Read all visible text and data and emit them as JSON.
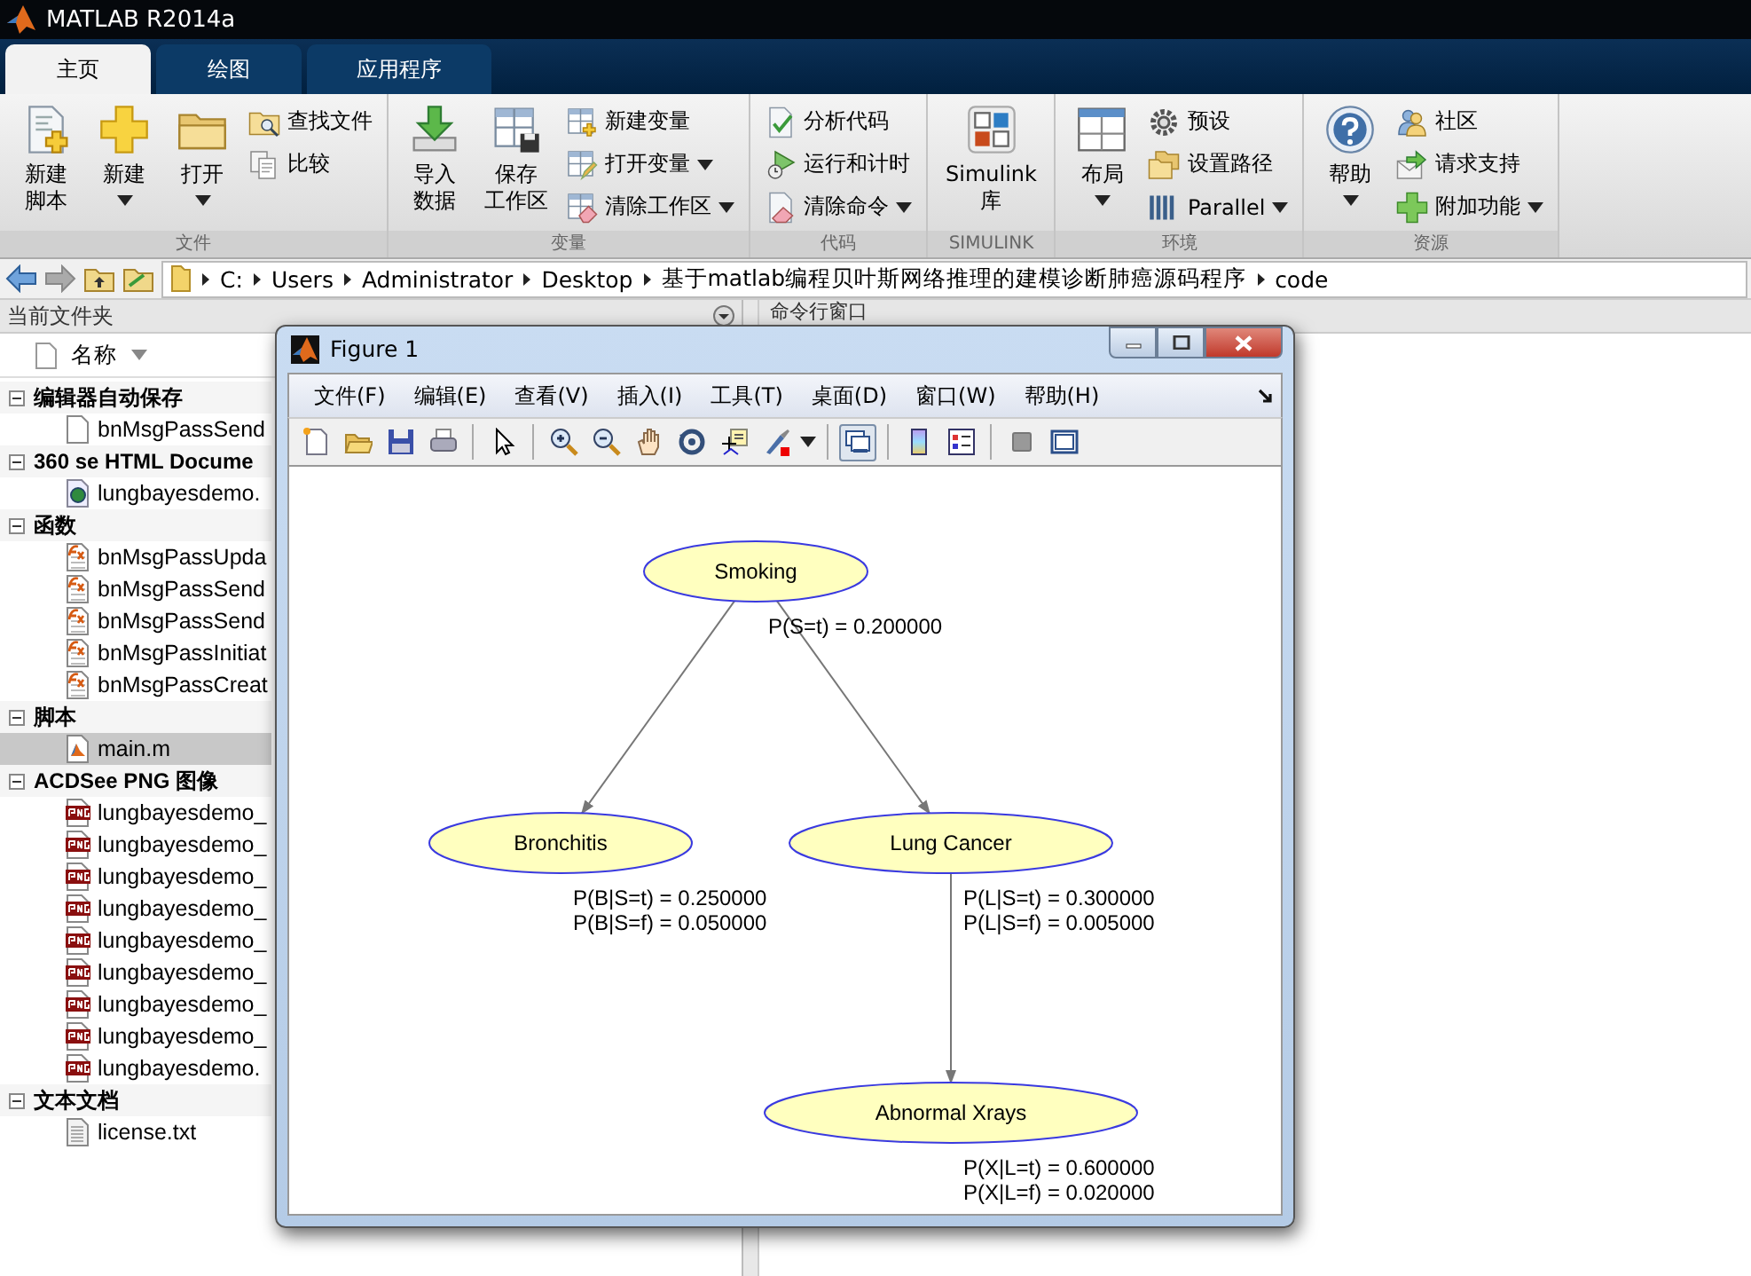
{
  "window": {
    "title": "MATLAB R2014a"
  },
  "tabs": [
    {
      "label": "主页",
      "selected": true
    },
    {
      "label": "绘图",
      "selected": false
    },
    {
      "label": "应用程序",
      "selected": false
    }
  ],
  "toolstrip": [
    {
      "label": "文件",
      "buttons": [
        {
          "kind": "large",
          "lines": [
            "新建",
            "脚本"
          ],
          "dropdown": false
        },
        {
          "kind": "large",
          "lines": [
            "新建"
          ],
          "dropdown": true
        },
        {
          "kind": "large",
          "lines": [
            "打开"
          ],
          "dropdown": true
        },
        {
          "kind": "small",
          "label": "查找文件",
          "dropdown": false
        },
        {
          "kind": "small",
          "label": "比较",
          "dropdown": false
        }
      ]
    },
    {
      "label": "变量",
      "buttons": [
        {
          "kind": "large",
          "lines": [
            "导入",
            "数据"
          ],
          "dropdown": false
        },
        {
          "kind": "large",
          "lines": [
            "保存",
            "工作区"
          ],
          "dropdown": false
        },
        {
          "kind": "small",
          "label": "新建变量",
          "dropdown": false
        },
        {
          "kind": "small",
          "label": "打开变量",
          "dropdown": true
        },
        {
          "kind": "small",
          "label": "清除工作区",
          "dropdown": true
        }
      ]
    },
    {
      "label": "代码",
      "buttons": [
        {
          "kind": "small",
          "label": "分析代码",
          "dropdown": false
        },
        {
          "kind": "small",
          "label": "运行和计时",
          "dropdown": false
        },
        {
          "kind": "small",
          "label": "清除命令",
          "dropdown": true
        }
      ]
    },
    {
      "label": "SIMULINK",
      "buttons": [
        {
          "kind": "large",
          "lines": [
            "Simulink",
            "库"
          ],
          "dropdown": false
        }
      ]
    },
    {
      "label": "环境",
      "buttons": [
        {
          "kind": "large",
          "lines": [
            "布局"
          ],
          "dropdown": true
        },
        {
          "kind": "small",
          "label": "预设",
          "dropdown": false
        },
        {
          "kind": "small",
          "label": "设置路径",
          "dropdown": false
        },
        {
          "kind": "small",
          "label": "Parallel",
          "dropdown": true
        }
      ]
    },
    {
      "label": "资源",
      "buttons": [
        {
          "kind": "large",
          "lines": [
            "帮助"
          ],
          "dropdown": true
        },
        {
          "kind": "small",
          "label": "社区",
          "dropdown": false
        },
        {
          "kind": "small",
          "label": "请求支持",
          "dropdown": false
        },
        {
          "kind": "small",
          "label": "附加功能",
          "dropdown": true
        }
      ]
    }
  ],
  "address_bar": {
    "segments": [
      "C:",
      "Users",
      "Administrator",
      "Desktop",
      "基于matlab编程贝叶斯网络推理的建模诊断肺癌源码程序",
      "code"
    ]
  },
  "current_folder": {
    "title": "当前文件夹",
    "column": "名称",
    "groups": [
      {
        "label": "编辑器自动保存",
        "expanded": true,
        "items": [
          {
            "kind": "blank",
            "name": "bnMsgPassSend",
            "selected": false
          }
        ]
      },
      {
        "label": "360 se HTML Docume",
        "expanded": true,
        "items": [
          {
            "kind": "web",
            "name": "lungbayesdemo.",
            "selected": false
          }
        ]
      },
      {
        "label": "函数",
        "expanded": true,
        "items": [
          {
            "kind": "function",
            "name": "bnMsgPassUpda",
            "selected": false
          },
          {
            "kind": "function",
            "name": "bnMsgPassSend",
            "selected": false
          },
          {
            "kind": "function",
            "name": "bnMsgPassSend",
            "selected": false
          },
          {
            "kind": "function",
            "name": "bnMsgPassInitiat",
            "selected": false
          },
          {
            "kind": "function",
            "name": "bnMsgPassCreat",
            "selected": false
          }
        ]
      },
      {
        "label": "脚本",
        "expanded": true,
        "items": [
          {
            "kind": "script",
            "name": "main.m",
            "selected": true
          }
        ]
      },
      {
        "label": "ACDSee PNG 图像",
        "expanded": true,
        "items": [
          {
            "kind": "png",
            "name": "lungbayesdemo_",
            "selected": false
          },
          {
            "kind": "png",
            "name": "lungbayesdemo_",
            "selected": false
          },
          {
            "kind": "png",
            "name": "lungbayesdemo_",
            "selected": false
          },
          {
            "kind": "png",
            "name": "lungbayesdemo_",
            "selected": false
          },
          {
            "kind": "png",
            "name": "lungbayesdemo_",
            "selected": false
          },
          {
            "kind": "png",
            "name": "lungbayesdemo_",
            "selected": false
          },
          {
            "kind": "png",
            "name": "lungbayesdemo_",
            "selected": false
          },
          {
            "kind": "png",
            "name": "lungbayesdemo_",
            "selected": false
          },
          {
            "kind": "png",
            "name": "lungbayesdemo.",
            "selected": false
          }
        ]
      },
      {
        "label": "文本文档",
        "expanded": true,
        "items": [
          {
            "kind": "text",
            "name": "license.txt",
            "selected": false
          }
        ]
      }
    ]
  },
  "command_window": {
    "title": "命令行窗口"
  },
  "figure": {
    "title": "Figure 1",
    "menu": [
      "文件(F)",
      "编辑(E)",
      "查看(V)",
      "插入(I)",
      "工具(T)",
      "桌面(D)",
      "窗口(W)",
      "帮助(H)"
    ],
    "toolbar": [
      {
        "pressed": false
      },
      {
        "pressed": false
      },
      {
        "pressed": false
      },
      {
        "pressed": false
      },
      {
        "pressed": false
      },
      {
        "pressed": false
      },
      {
        "pressed": false
      },
      {
        "pressed": false
      },
      {
        "pressed": false
      },
      {
        "pressed": false
      },
      {
        "pressed": false
      },
      {
        "pressed": true
      },
      {
        "pressed": false
      },
      {
        "pressed": false
      },
      {
        "pressed": false
      },
      {
        "pressed": false
      }
    ],
    "graph": {
      "nodes": [
        {
          "label": "Smoking",
          "probabilities": [
            "P(S=t) = 0.200000"
          ]
        },
        {
          "label": "Bronchitis",
          "probabilities": [
            "P(B|S=t) = 0.250000",
            "P(B|S=f) = 0.050000"
          ]
        },
        {
          "label": "Lung Cancer",
          "probabilities": [
            "P(L|S=t) = 0.300000",
            "P(L|S=f) = 0.005000"
          ]
        },
        {
          "label": "Abnormal Xrays",
          "probabilities": [
            "P(X|L=t) = 0.600000",
            "P(X|L=f) = 0.020000"
          ]
        }
      ]
    }
  }
}
